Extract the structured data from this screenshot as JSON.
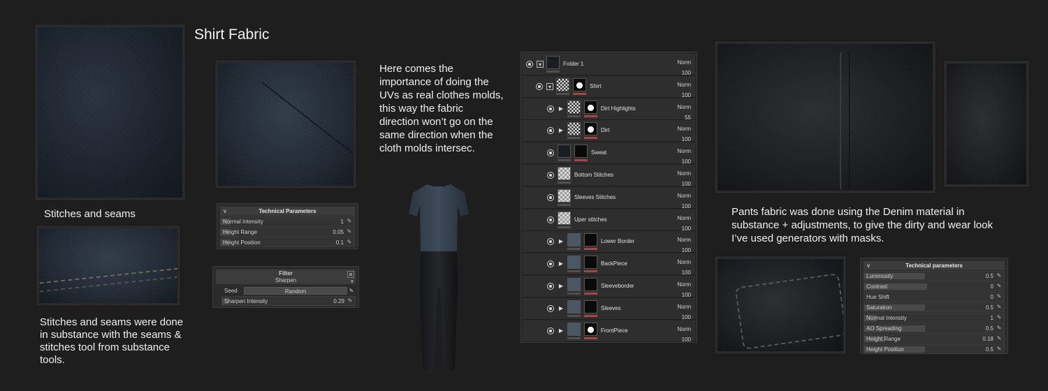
{
  "title": "Shirt Fabric",
  "captions": {
    "stitches_label": "Stitches and seams",
    "stitches_text": "Stitches and seams were done in substance with the seams & stitches tool from substance tools.",
    "uv_text": "Here comes the importance of doing the UVs as real clothes molds, this way the fabric direction won’t go on the same direction when the cloth molds intersec.",
    "pants_text": "Pants fabric was done using the Denim material in substance + adjustments, to give the dirty and wear look I’ve used generators with masks."
  },
  "tech_params_small": {
    "title": "Technical Parameters",
    "rows": [
      {
        "label": "Normal Intensity",
        "value": "1",
        "fill": 0.08
      },
      {
        "label": "Height Range",
        "value": "0.05",
        "fill": 0.08
      },
      {
        "label": "Height Position",
        "value": "0.1",
        "fill": 0.08
      }
    ]
  },
  "filter_panel": {
    "title": "Filter",
    "subtitle": "Sharpen",
    "close": "✕",
    "seed_label": "Seed",
    "seed_button": "Random",
    "rows": [
      {
        "label": "Sharpen Intensity",
        "value": "0.29",
        "fill": 0.06
      }
    ]
  },
  "tech_params_large": {
    "title": "Technical parameters",
    "rows": [
      {
        "label": "Luminosity",
        "value": "0.5",
        "fill": 0.5
      },
      {
        "label": "Contrast",
        "value": "0",
        "fill": 0.5
      },
      {
        "label": "Hue Shift",
        "value": "0",
        "fill": 0.0
      },
      {
        "label": "Saturation",
        "value": "0.5",
        "fill": 0.5
      },
      {
        "label": "Normal Intensity",
        "value": "1",
        "fill": 0.1
      },
      {
        "label": "AO Spreading",
        "value": "0.5",
        "fill": 0.5
      },
      {
        "label": "Height Range",
        "value": "0.18",
        "fill": 0.18
      },
      {
        "label": "Height Position",
        "value": "0.5",
        "fill": 0.5
      }
    ]
  },
  "layers": [
    {
      "name": "Folder 1",
      "blend": "Norm",
      "opacity": "100",
      "level": 0,
      "kind": "folder",
      "thumb": "dark",
      "mask": "none"
    },
    {
      "name": "Shirt",
      "blend": "Norm",
      "opacity": "100",
      "level": 1,
      "kind": "folder",
      "thumb": "pattern",
      "mask": "white"
    },
    {
      "name": "Dirt Highlights",
      "blend": "Norm",
      "opacity": "55",
      "level": 2,
      "kind": "fill",
      "thumb": "pattern",
      "mask": "white"
    },
    {
      "name": "Dirt",
      "blend": "Norm",
      "opacity": "100",
      "level": 2,
      "kind": "fill",
      "thumb": "pattern",
      "mask": "white"
    },
    {
      "name": "Sweat",
      "blend": "Norm",
      "opacity": "100",
      "level": 2,
      "kind": "paint",
      "thumb": "dark",
      "mask": "dark"
    },
    {
      "name": "Bottom Stitches",
      "blend": "Norm",
      "opacity": "100",
      "level": 2,
      "kind": "plain",
      "thumb": "check",
      "mask": "none"
    },
    {
      "name": "Sleeves Stitches",
      "blend": "Norm",
      "opacity": "100",
      "level": 2,
      "kind": "plain",
      "thumb": "check",
      "mask": "none"
    },
    {
      "name": "Uper stitches",
      "blend": "Norm",
      "opacity": "100",
      "level": 2,
      "kind": "plain",
      "thumb": "check",
      "mask": "none"
    },
    {
      "name": "Lower Border",
      "blend": "Norm",
      "opacity": "100",
      "level": 2,
      "kind": "fill",
      "thumb": "blue",
      "mask": "dark"
    },
    {
      "name": "BackPiece",
      "blend": "Norm",
      "opacity": "100",
      "level": 2,
      "kind": "fill",
      "thumb": "blue",
      "mask": "dark"
    },
    {
      "name": "Sleeveborder",
      "blend": "Norm",
      "opacity": "100",
      "level": 2,
      "kind": "fill",
      "thumb": "blue",
      "mask": "dark"
    },
    {
      "name": "Sleeves",
      "blend": "Norm",
      "opacity": "100",
      "level": 2,
      "kind": "fill",
      "thumb": "blue",
      "mask": "dark"
    },
    {
      "name": "FrontPiece",
      "blend": "Norm",
      "opacity": "100",
      "level": 2,
      "kind": "fill",
      "thumb": "blue",
      "mask": "white"
    }
  ]
}
